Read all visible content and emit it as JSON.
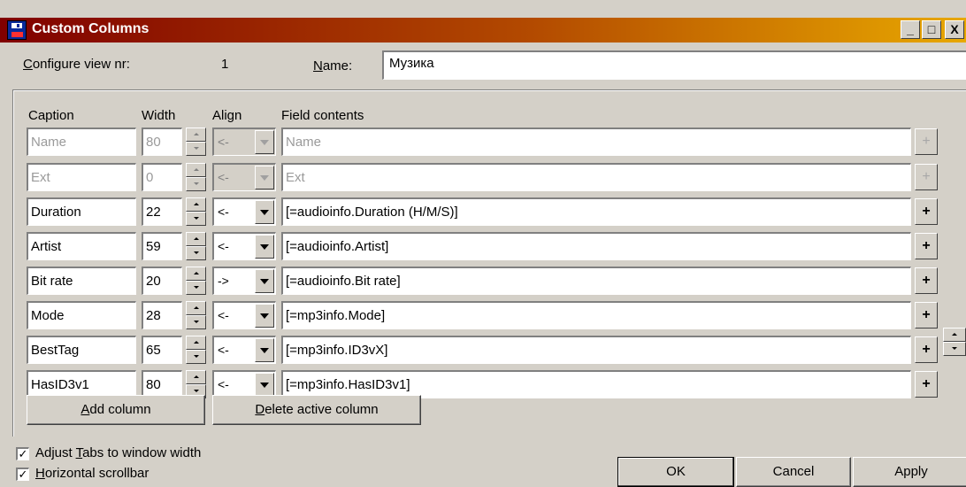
{
  "window": {
    "title": "Custom Columns",
    "minimize": "_",
    "maximize": "□",
    "close": "X"
  },
  "config": {
    "view_label": "Configure view nr:",
    "view_nr": "1",
    "name_label": "Name:",
    "name_value": "Музика"
  },
  "headers": {
    "caption": "Caption",
    "width": "Width",
    "align": "Align",
    "field": "Field contents"
  },
  "rows": [
    {
      "caption": "Name",
      "width": "80",
      "align": "<-",
      "field": "Name",
      "plus": "+",
      "enabled": false
    },
    {
      "caption": "Ext",
      "width": "0",
      "align": "<-",
      "field": "Ext",
      "plus": "+",
      "enabled": false
    },
    {
      "caption": "Duration",
      "width": "22",
      "align": "<-",
      "field": "[=audioinfo.Duration (H/M/S)]",
      "plus": "+",
      "enabled": true
    },
    {
      "caption": "Artist",
      "width": "59",
      "align": "<-",
      "field": "[=audioinfo.Artist]",
      "plus": "+",
      "enabled": true
    },
    {
      "caption": "Bit rate",
      "width": "20",
      "align": "->",
      "field": "[=audioinfo.Bit rate]",
      "plus": "+",
      "enabled": true
    },
    {
      "caption": "Mode",
      "width": "28",
      "align": "<-",
      "field": "[=mp3info.Mode]",
      "plus": "+",
      "enabled": true
    },
    {
      "caption": "BestTag",
      "width": "65",
      "align": "<-",
      "field": "[=mp3info.ID3vX]",
      "plus": "+",
      "enabled": true
    },
    {
      "caption": "HasID3v1",
      "width": "80",
      "align": "<-",
      "field": "[=mp3info.HasID3v1]",
      "plus": "+",
      "enabled": true
    }
  ],
  "buttons": {
    "add_column": "Add column",
    "delete_column": "Delete active column",
    "ok": "OK",
    "cancel": "Cancel",
    "apply": "Apply"
  },
  "options": {
    "adjust_tabs": {
      "label": "Adjust Tabs to window width",
      "checked": true
    },
    "horizontal_scrollbar": {
      "label": "Horizontal scrollbar",
      "checked": true
    }
  },
  "colors": {
    "title_gradient_start": "#800000",
    "title_gradient_end": "#e8a800",
    "face": "#d4d0c8"
  }
}
